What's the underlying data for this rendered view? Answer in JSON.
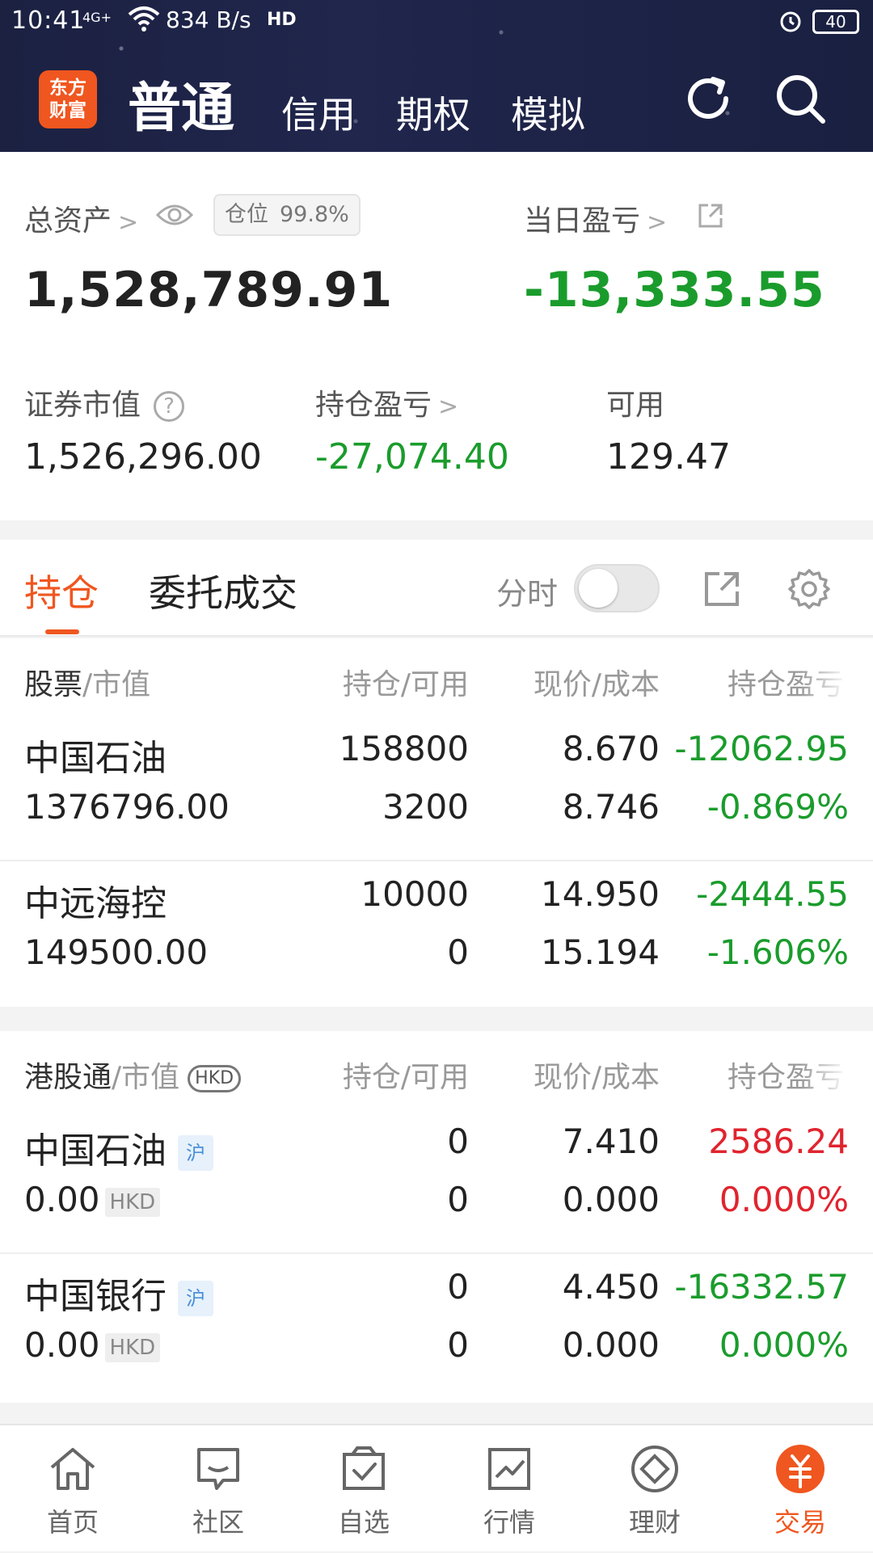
{
  "status_bar": {
    "time": "10:41",
    "network": "4G+",
    "speed": "834 B/s",
    "hd": "HD",
    "battery": "40"
  },
  "header": {
    "logo_line1": "东方",
    "logo_line2": "财富",
    "tabs": [
      "普通",
      "信用",
      "期权",
      "模拟"
    ],
    "active_tab": "普通"
  },
  "summary": {
    "total_assets_label": "总资产",
    "position_label": "仓位",
    "position_value": "99.8%",
    "total_assets_value": "1,528,789.91",
    "daily_pl_label": "当日盈亏",
    "daily_pl_value": "-13,333.55",
    "market_value_label": "证券市值",
    "market_value": "1,526,296.00",
    "holding_pl_label": "持仓盈亏",
    "holding_pl_value": "-27,074.40",
    "available_label": "可用",
    "available_value": "129.47"
  },
  "tabs": {
    "holdings": "持仓",
    "orders": "委托成交",
    "fenshi": "分时"
  },
  "stocks_table": {
    "header": {
      "col1_key": "股票",
      "col1_sub": "/市值",
      "col2": "持仓/可用",
      "col3": "现价/成本",
      "col4": "持仓盈亏"
    },
    "rows": [
      {
        "name": "中国石油",
        "market_value": "1376796.00",
        "holding": "158800",
        "available": "3200",
        "price": "8.670",
        "cost": "8.746",
        "pl": "-12062.95",
        "pl_pct": "-0.869%"
      },
      {
        "name": "中远海控",
        "market_value": "149500.00",
        "holding": "10000",
        "available": "0",
        "price": "14.950",
        "cost": "15.194",
        "pl": "-2444.55",
        "pl_pct": "-1.606%"
      }
    ]
  },
  "hk_table": {
    "header": {
      "col1_key": "港股通",
      "col1_sub": "/市值",
      "currency": "HKD",
      "col2": "持仓/可用",
      "col3": "现价/成本",
      "col4": "持仓盈亏"
    },
    "rows": [
      {
        "name": "中国石油",
        "tag": "沪",
        "market_value": "0.00",
        "currency": "HKD",
        "holding": "0",
        "available": "0",
        "price": "7.410",
        "cost": "0.000",
        "pl": "2586.24",
        "pl_pct": "0.000%"
      },
      {
        "name": "中国银行",
        "tag": "沪",
        "market_value": "0.00",
        "currency": "HKD",
        "holding": "0",
        "available": "0",
        "price": "4.450",
        "cost": "0.000",
        "pl": "-16332.57",
        "pl_pct": "0.000%"
      }
    ]
  },
  "bottom_nav": [
    {
      "label": "首页",
      "icon": "home-icon"
    },
    {
      "label": "社区",
      "icon": "chat-icon"
    },
    {
      "label": "自选",
      "icon": "checkbox-icon"
    },
    {
      "label": "行情",
      "icon": "chart-icon"
    },
    {
      "label": "理财",
      "icon": "diamond-icon"
    },
    {
      "label": "交易",
      "icon": "yuan-icon"
    }
  ],
  "colors": {
    "accent": "#f0561f",
    "loss": "#1a9c2c",
    "gain": "#e0242e",
    "header_bg": "#1f2448"
  }
}
